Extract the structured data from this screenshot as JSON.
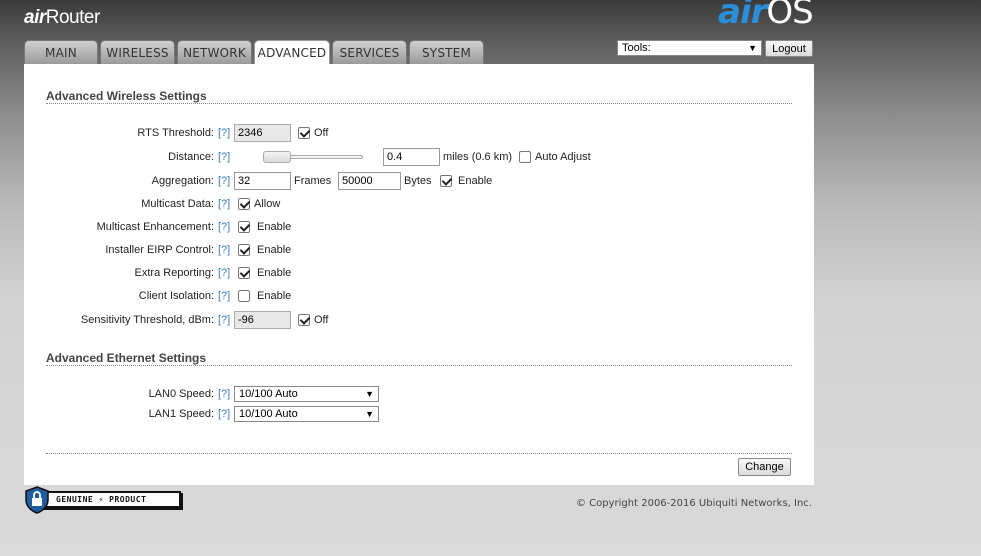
{
  "header": {
    "logo_air": "air",
    "logo_product": "Router",
    "brand_air": "air",
    "brand_os": "OS"
  },
  "tabs": [
    {
      "label": "MAIN"
    },
    {
      "label": "WIRELESS"
    },
    {
      "label": "NETWORK"
    },
    {
      "label": "ADVANCED",
      "active": true
    },
    {
      "label": "SERVICES"
    },
    {
      "label": "SYSTEM"
    }
  ],
  "toolbar": {
    "tools_value": "Tools:",
    "logout_label": "Logout"
  },
  "wireless_section": {
    "title": "Advanced Wireless Settings",
    "help": "[?]",
    "rts": {
      "label": "RTS Threshold:",
      "value": "2346",
      "off_checked": true,
      "off_label": "Off"
    },
    "distance": {
      "label": "Distance:",
      "value": "0.4",
      "unit_text": "miles (0.6 km)",
      "auto_adjust_label": "Auto Adjust",
      "auto_adjust_checked": false,
      "slider_fraction": 0.0
    },
    "aggregation": {
      "label": "Aggregation:",
      "frames_value": "32",
      "frames_label": "Frames",
      "bytes_value": "50000",
      "bytes_label": "Bytes",
      "enable_checked": true,
      "enable_label": "Enable"
    },
    "multicast_data": {
      "label": "Multicast Data:",
      "checked": true,
      "option_label": "Allow"
    },
    "multicast_enhancement": {
      "label": "Multicast Enhancement:",
      "checked": true,
      "option_label": "Enable"
    },
    "installer_eirp": {
      "label": "Installer EIRP Control:",
      "checked": true,
      "option_label": "Enable"
    },
    "extra_reporting": {
      "label": "Extra Reporting:",
      "checked": true,
      "option_label": "Enable"
    },
    "client_isolation": {
      "label": "Client Isolation:",
      "checked": false,
      "option_label": "Enable"
    },
    "sensitivity": {
      "label": "Sensitivity Threshold, dBm:",
      "value": "-96",
      "off_checked": true,
      "off_label": "Off"
    }
  },
  "ethernet_section": {
    "title": "Advanced Ethernet Settings",
    "lan0": {
      "label": "LAN0 Speed:",
      "value": "10/100 Auto"
    },
    "lan1": {
      "label": "LAN1 Speed:",
      "value": "10/100 Auto"
    }
  },
  "actions": {
    "change_label": "Change"
  },
  "footer": {
    "badge_text": "GENUINE  ⚡  PRODUCT",
    "copyright": "© Copyright 2006-2016 Ubiquiti Networks, Inc."
  }
}
